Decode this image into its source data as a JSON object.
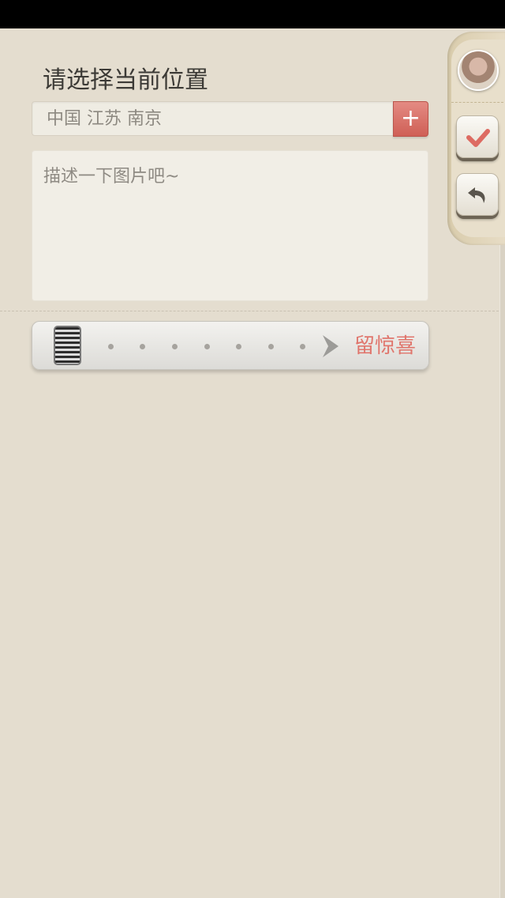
{
  "location": {
    "title": "请选择当前位置",
    "current_value": "中国 江苏 南京",
    "add_button_label": "+"
  },
  "description": {
    "placeholder": "描述一下图片吧~"
  },
  "surprise": {
    "label": "留惊喜"
  },
  "side_panel": {
    "items": [
      {
        "icon": "avatar"
      },
      {
        "icon": "checkmark-icon"
      },
      {
        "icon": "undo-icon"
      }
    ]
  },
  "colors": {
    "background": "#e4ddcf",
    "accent": "#d9645b",
    "accent_text": "#e0766d"
  }
}
